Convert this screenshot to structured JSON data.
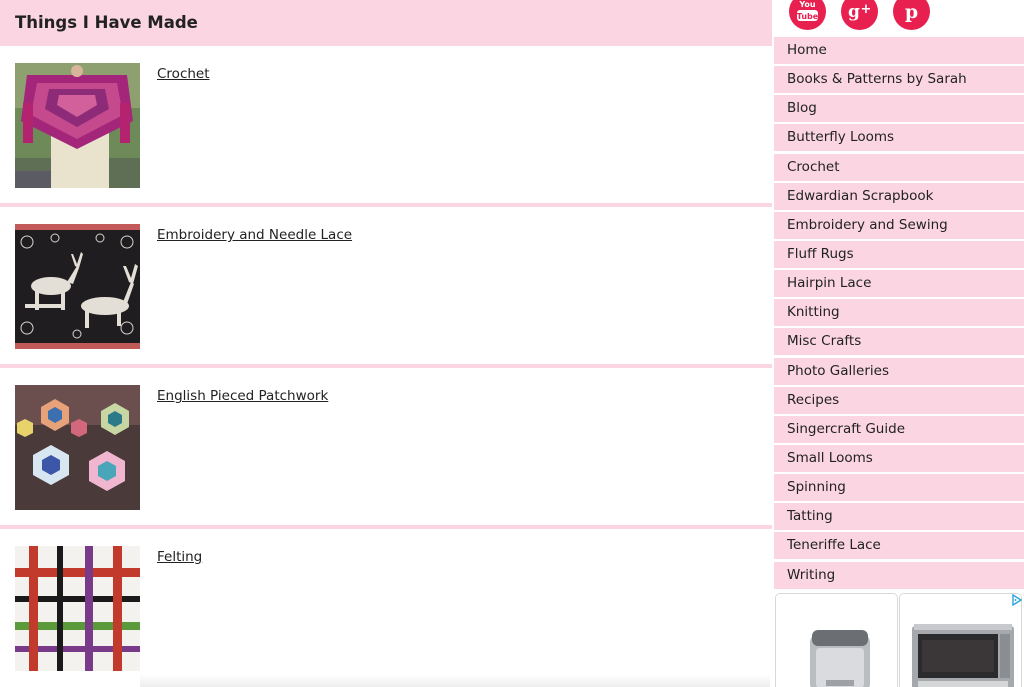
{
  "page": {
    "title": "Things I Have Made"
  },
  "entries": [
    {
      "title": "Crochet"
    },
    {
      "title": "Embroidery and Needle Lace"
    },
    {
      "title": "English Pieced Patchwork"
    },
    {
      "title": "Felting"
    }
  ],
  "social": [
    {
      "icon": "youtube-icon",
      "label": "You Tube"
    },
    {
      "icon": "google-plus-icon",
      "label": "g+"
    },
    {
      "icon": "pinterest-icon",
      "label": "p"
    }
  ],
  "nav": [
    {
      "label": "Home"
    },
    {
      "label": "Books & Patterns by Sarah"
    },
    {
      "label": "Blog"
    },
    {
      "label": "Butterfly Looms"
    },
    {
      "label": "Crochet"
    },
    {
      "label": "Edwardian Scrapbook"
    },
    {
      "label": "Embroidery and Sewing"
    },
    {
      "label": "Fluff Rugs"
    },
    {
      "label": "Hairpin Lace"
    },
    {
      "label": "Knitting"
    },
    {
      "label": "Misc Crafts"
    },
    {
      "label": "Photo Galleries"
    },
    {
      "label": "Recipes"
    },
    {
      "label": "Singercraft Guide"
    },
    {
      "label": "Small Looms"
    },
    {
      "label": "Spinning"
    },
    {
      "label": "Tatting"
    },
    {
      "label": "Teneriffe Lace"
    },
    {
      "label": "Writing"
    }
  ],
  "colors": {
    "accent_pink": "#fbd6e2",
    "social_red": "#e8204f",
    "ad_choice_blue": "#2aa7e0"
  }
}
